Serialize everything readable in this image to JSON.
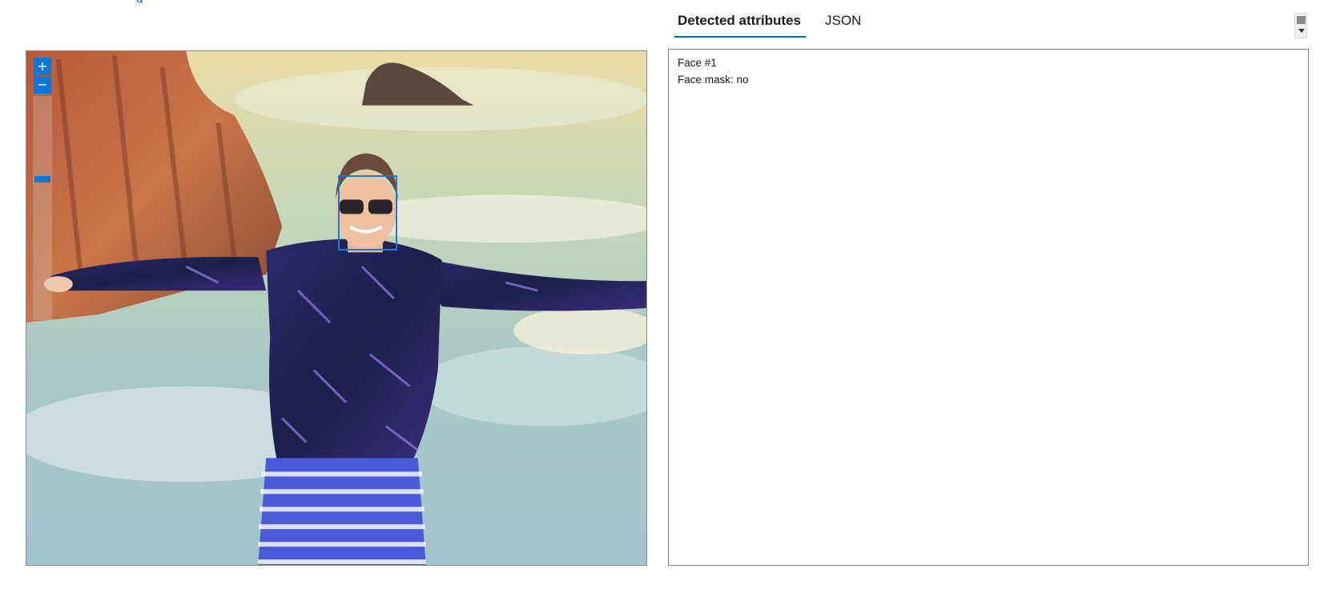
{
  "top_link": {
    "text": "g"
  },
  "tabs": [
    {
      "label": "Detected attributes",
      "active": true
    },
    {
      "label": "JSON",
      "active": false
    }
  ],
  "image_viewer": {
    "zoom_in_label": "+",
    "zoom_out_label": "−",
    "zoom_level": 0.46,
    "photo_icon": "beach-person-photo",
    "face_box_color": "#1c78d0"
  },
  "results": {
    "lines": [
      "Face #1",
      "Face mask: no"
    ]
  },
  "colors": {
    "accent": "#0067b8",
    "control_blue": "#0b78d6"
  }
}
